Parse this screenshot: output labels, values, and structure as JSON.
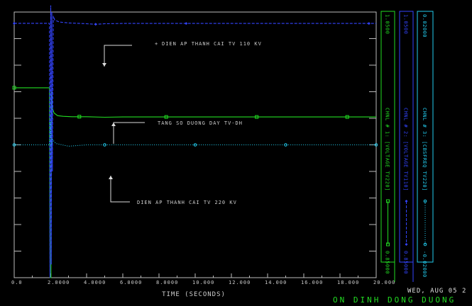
{
  "chart_data": {
    "type": "line",
    "xlabel": "TIME (SECONDS)",
    "xlim": [
      0,
      20
    ],
    "x_ticks": [
      "0.0",
      "2.0000",
      "4.0000",
      "6.0000",
      "8.0000",
      "10.000",
      "12.000",
      "14.000",
      "16.000",
      "18.000",
      "20.000"
    ],
    "series": [
      {
        "channel_label": "CHNL # 1: [VOLTAGE TV220]",
        "color": "#22dd22",
        "axis_top": "1.0500",
        "axis_bottom": "0.85000",
        "ylim": [
          0.85,
          1.05
        ],
        "annotation": "DIEN AP THANH CAI TV 220 KV",
        "points": [
          [
            0,
            0.993
          ],
          [
            1.95,
            0.993
          ],
          [
            1.98,
            0.85
          ],
          [
            2.03,
            0.85
          ],
          [
            2.06,
            0.99
          ],
          [
            2.1,
            0.978
          ],
          [
            2.2,
            0.974
          ],
          [
            2.4,
            0.972
          ],
          [
            2.7,
            0.9715
          ],
          [
            3.2,
            0.9712
          ],
          [
            4,
            0.9712
          ],
          [
            5,
            0.9708
          ],
          [
            6,
            0.971
          ],
          [
            8,
            0.971
          ],
          [
            10,
            0.971
          ],
          [
            12,
            0.971
          ],
          [
            14,
            0.971
          ],
          [
            16,
            0.971
          ],
          [
            18,
            0.971
          ],
          [
            20,
            0.971
          ]
        ]
      },
      {
        "channel_label": "CHNL # 2: [VOLTAGE TV110]",
        "color": "#3344ff",
        "axis_top": "1.0500",
        "axis_bottom": "0.85000",
        "ylim": [
          0.85,
          1.05
        ],
        "annotation": "DIEN AP THANH CAI TV 110 KV",
        "points": [
          [
            0,
            1.0415
          ],
          [
            1.95,
            1.0415
          ],
          [
            1.98,
            0.85
          ],
          [
            2.02,
            1.055
          ],
          [
            2.05,
            0.86
          ],
          [
            2.08,
            1.05
          ],
          [
            2.11,
            0.93
          ],
          [
            2.16,
            1.047
          ],
          [
            2.24,
            1.044
          ],
          [
            2.5,
            1.0425
          ],
          [
            3,
            1.0418
          ],
          [
            3.5,
            1.0415
          ],
          [
            4,
            1.0412
          ],
          [
            4.5,
            1.0408
          ],
          [
            5,
            1.0412
          ],
          [
            6,
            1.0414
          ],
          [
            8,
            1.0414
          ],
          [
            10,
            1.0414
          ],
          [
            12,
            1.0414
          ],
          [
            14,
            1.0414
          ],
          [
            16,
            1.0414
          ],
          [
            18,
            1.0414
          ],
          [
            20,
            1.0414
          ]
        ]
      },
      {
        "channel_label": "CHNL # 3: [CBSFREQ TV220]",
        "color": "#22ccee",
        "axis_top": "0.02000",
        "axis_bottom": "-0.02000",
        "ylim": [
          -0.02,
          0.02
        ],
        "annotation": "TANG SO DUONG DAY TV-DH",
        "points": [
          [
            0,
            0.0
          ],
          [
            1.95,
            0.0
          ],
          [
            2.0,
            0.0035
          ],
          [
            2.05,
            -0.0002
          ],
          [
            2.12,
            0.0008
          ],
          [
            2.3,
            0.0002
          ],
          [
            3,
            -0.0002
          ],
          [
            4,
            0.0
          ],
          [
            5,
            0.0
          ],
          [
            8,
            0.0
          ],
          [
            12,
            0.0
          ],
          [
            16,
            0.0
          ],
          [
            20,
            0.0
          ]
        ]
      }
    ],
    "footer_date": "WED, AUG 05 2",
    "footer_title": "ON DINH DONG DUONG"
  }
}
